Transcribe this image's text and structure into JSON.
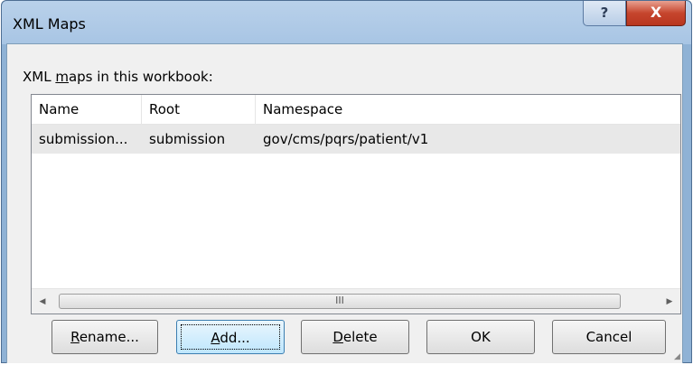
{
  "window": {
    "title": "XML Maps",
    "help_glyph": "?",
    "close_glyph": "X"
  },
  "maps_label": {
    "prefix": "XML ",
    "underlined": "m",
    "suffix": "aps in this workbook:"
  },
  "table": {
    "columns": [
      "Name",
      "Root",
      "Namespace"
    ],
    "rows": [
      {
        "name": "submission...",
        "root": "submission",
        "namespace": "gov/cms/pqrs/patient/v1"
      }
    ]
  },
  "scrollbar": {
    "left_arrow": "◀",
    "right_arrow": "▶",
    "thumb_grip": "III"
  },
  "buttons": {
    "rename": {
      "mnemonic": "R",
      "rest": "ename..."
    },
    "add": {
      "mnemonic": "A",
      "rest": "dd..."
    },
    "delete": {
      "mnemonic": "D",
      "rest": "elete"
    },
    "ok": "OK",
    "cancel": "Cancel"
  },
  "colors": {
    "frame": "#8fb2d5",
    "close_button": "#c6452d",
    "selected_row": "#e8e8e8"
  }
}
